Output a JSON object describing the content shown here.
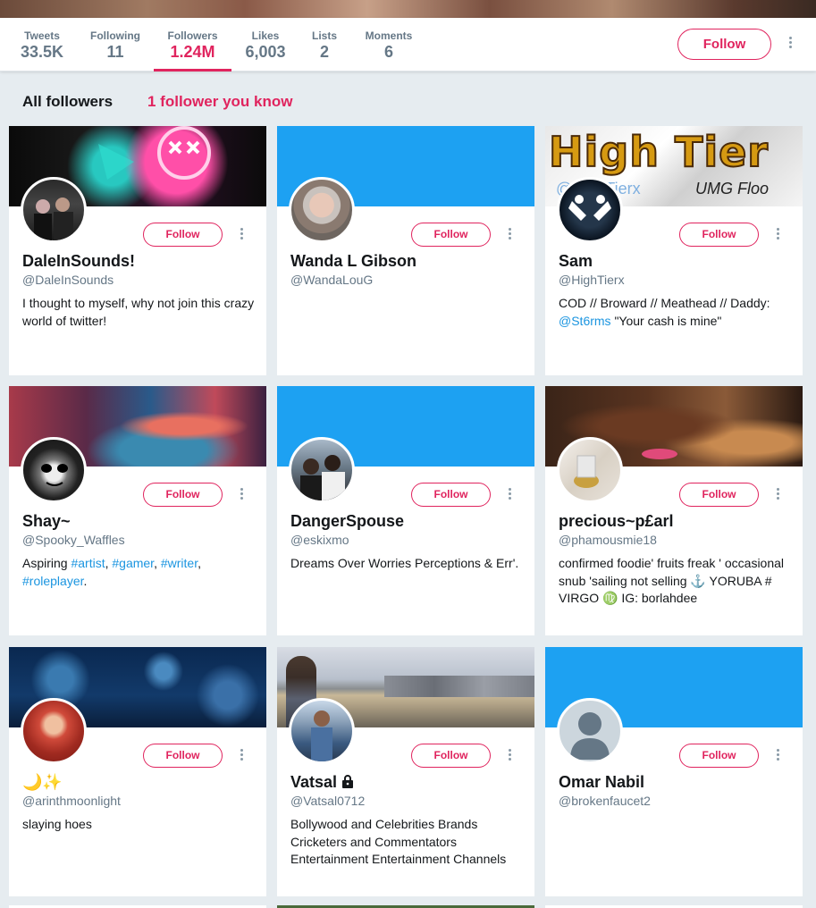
{
  "nav": {
    "stats": [
      {
        "label": "Tweets",
        "value": "33.5K"
      },
      {
        "label": "Following",
        "value": "11"
      },
      {
        "label": "Followers",
        "value": "1.24M"
      },
      {
        "label": "Likes",
        "value": "6,003"
      },
      {
        "label": "Lists",
        "value": "2"
      },
      {
        "label": "Moments",
        "value": "6"
      }
    ],
    "active_tab": "Followers",
    "follow_label": "Follow"
  },
  "filters": {
    "all": "All followers",
    "known": "1 follower you know"
  },
  "colors": {
    "accent": "#e0245e",
    "link": "#1b95e0",
    "default_banner": "#1da1f2",
    "background": "#e6ecf0"
  },
  "follow_label": "Follow",
  "cards": [
    {
      "name": "DaleInSounds!",
      "handle": "@DaleInSounds",
      "bio": "I thought to myself, why not join this crazy world of twitter!"
    },
    {
      "name": "Wanda L Gibson",
      "handle": "@WandaLouG",
      "bio": ""
    },
    {
      "name": "Sam",
      "handle": "@HighTierx",
      "bio_pre": "COD // Broward // Meathead // Daddy: ",
      "bio_link": "@St6rms",
      "bio_post": " \"Your cash is mine\"",
      "banner_text": "High Tier",
      "banner_subtext": "@HighTierx",
      "banner_logo": "UMG Floo"
    },
    {
      "name": "Shay~",
      "handle": "@Spooky_Waffles",
      "bio_parts": [
        "Aspiring ",
        "#artist",
        ", ",
        "#gamer",
        ", ",
        "#writer",
        ", ",
        "#roleplayer",
        "."
      ]
    },
    {
      "name": "DangerSpouse",
      "handle": "@eskixmo",
      "bio": "Dreams Over Worries Perceptions & Err'."
    },
    {
      "name": "precious~p£arl",
      "handle": "@phamousmie18",
      "bio": "confirmed foodie' fruits freak ' occasional snub 'sailing not selling ⚓ YORUBA # VIRGO ♍ IG: borlahdee"
    },
    {
      "name": "🌙✨",
      "handle": "@arinthmoonlight",
      "bio": "slaying hoes"
    },
    {
      "name": "Vatsal",
      "handle": "@Vatsal0712",
      "bio": "Bollywood and Celebrities Brands Cricketers and Commentators Entertainment Entertainment Channels",
      "protected": true
    },
    {
      "name": "Omar Nabil",
      "handle": "@brokenfaucet2",
      "bio": ""
    }
  ]
}
